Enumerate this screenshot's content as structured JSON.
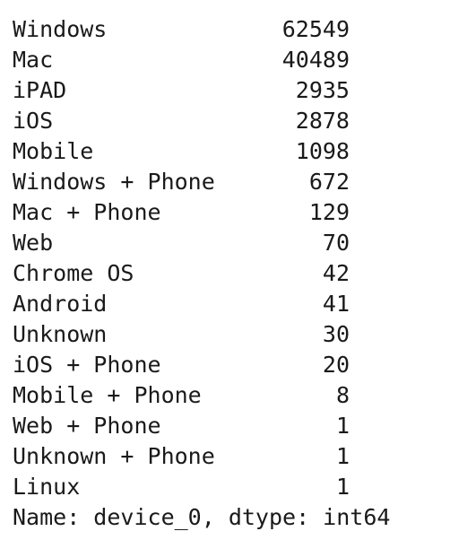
{
  "series_output": {
    "rows": [
      {
        "label": "Windows",
        "value": "62549"
      },
      {
        "label": "Mac",
        "value": "40489"
      },
      {
        "label": "iPAD",
        "value": "2935"
      },
      {
        "label": "iOS",
        "value": "2878"
      },
      {
        "label": "Mobile",
        "value": "1098"
      },
      {
        "label": "Windows + Phone",
        "value": "672"
      },
      {
        "label": "Mac + Phone",
        "value": "129"
      },
      {
        "label": "Web",
        "value": "70"
      },
      {
        "label": "Chrome OS",
        "value": "42"
      },
      {
        "label": "Android",
        "value": "41"
      },
      {
        "label": "Unknown",
        "value": "30"
      },
      {
        "label": "iOS + Phone",
        "value": "20"
      },
      {
        "label": "Mobile + Phone",
        "value": "8"
      },
      {
        "label": "Web + Phone",
        "value": "1"
      },
      {
        "label": "Unknown + Phone",
        "value": "1"
      },
      {
        "label": "Linux",
        "value": "1"
      }
    ],
    "footer": "Name: device_0, dtype: int64"
  }
}
